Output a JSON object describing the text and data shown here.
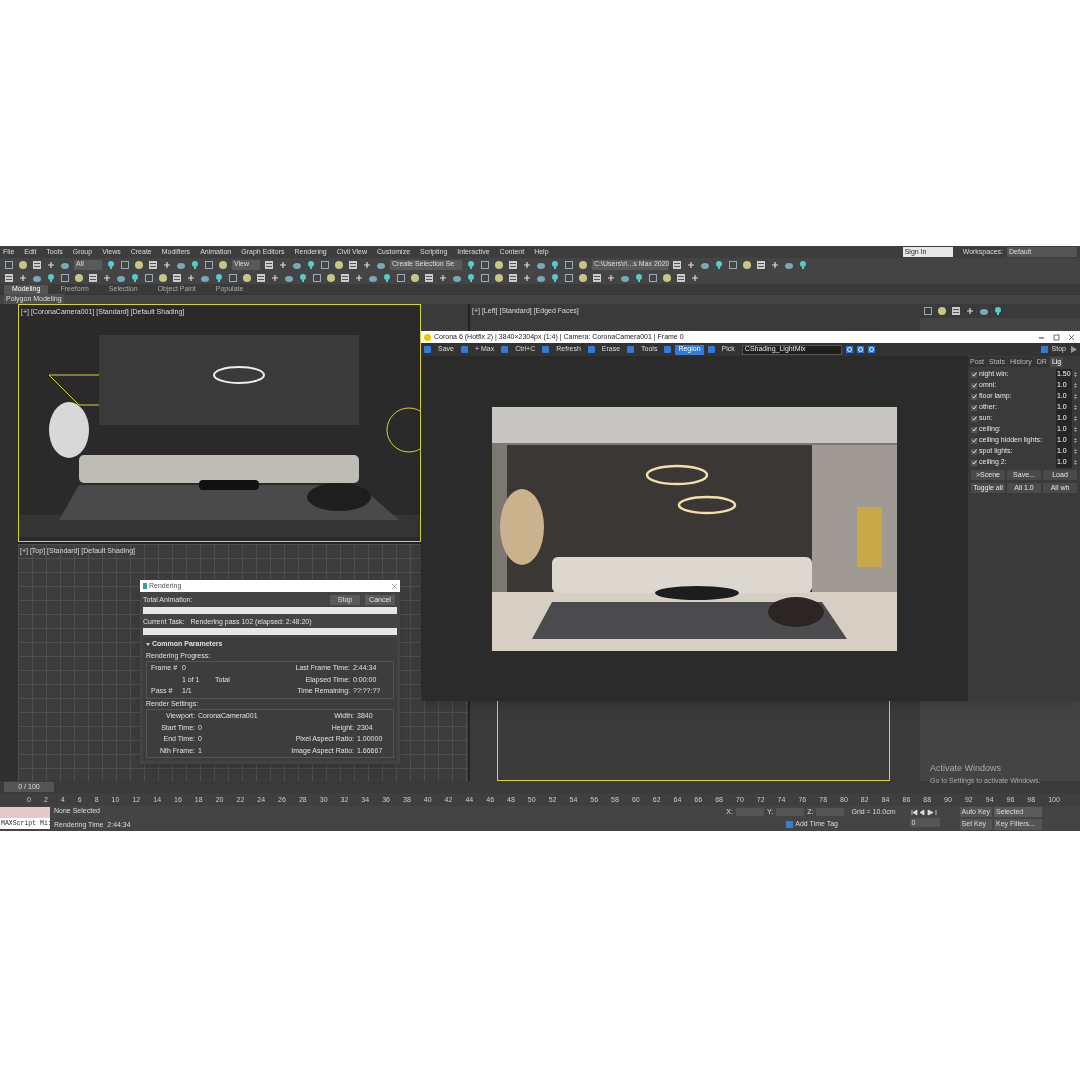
{
  "menu": [
    "File",
    "Edit",
    "Tools",
    "Group",
    "Views",
    "Create",
    "Modifiers",
    "Animation",
    "Graph Editors",
    "Rendering",
    "Civil View",
    "Customize",
    "Scripting",
    "Interactive",
    "Content",
    "Help"
  ],
  "account": {
    "sign_in": "Sign In",
    "workspaces_label": "Workspaces:",
    "workspace": "Default"
  },
  "toolbar": {
    "selection_filter": "All",
    "reference_coord": "View",
    "selection_set": "Create Selection Se",
    "project_path": "C:\\Users\\r\\...s Max 2020"
  },
  "ribbon_tabs": [
    {
      "label": "Modeling",
      "selected": true
    },
    {
      "label": "Freeform",
      "selected": false
    },
    {
      "label": "Selection",
      "selected": false
    },
    {
      "label": "Object Paint",
      "selected": false
    },
    {
      "label": "Populate",
      "selected": false
    }
  ],
  "ribbon_panel": "Polygon Modeling",
  "viewports": [
    {
      "kind": "camera",
      "label": "[+] [CoronaCamera001] [Standard] [Default Shading]"
    },
    {
      "kind": "side",
      "label": "[+] [Left] [Standard] [Edged Faces]"
    },
    {
      "kind": "top",
      "label": "[+] [Top] [Standard] [Default Shading]"
    },
    {
      "kind": "hidden"
    }
  ],
  "frame_buffer": {
    "title": "Corona 6 (Hotfix 2) | 3840×2304px (1:4) | Camera: CoronaCamera001 | Frame 0",
    "tools": [
      {
        "label": "Save",
        "selected": false
      },
      {
        "label": "+ Max",
        "selected": false
      },
      {
        "label": "Ctrl+C",
        "selected": false
      },
      {
        "label": "Refresh",
        "selected": false
      },
      {
        "label": "Erase",
        "selected": false
      },
      {
        "label": "Tools",
        "selected": false
      },
      {
        "label": "Region",
        "selected": true
      },
      {
        "label": "Pick",
        "selected": false
      }
    ],
    "render_element": "CShading_LightMix",
    "stop": "Stop",
    "tabs": [
      {
        "label": "Post",
        "selected": false
      },
      {
        "label": "Stats",
        "selected": false
      },
      {
        "label": "History",
        "selected": false
      },
      {
        "label": "DR",
        "selected": false
      },
      {
        "label": "Lig",
        "selected": true
      }
    ],
    "lights": [
      {
        "name": "night win:",
        "checked": true,
        "value": "1.50"
      },
      {
        "name": "omni:",
        "checked": true,
        "value": "1.0"
      },
      {
        "name": "floor lamp:",
        "checked": true,
        "value": "1.0"
      },
      {
        "name": "other:",
        "checked": true,
        "value": "1.0"
      },
      {
        "name": "sun:",
        "checked": true,
        "value": "1.0"
      },
      {
        "name": "ceiling:",
        "checked": true,
        "value": "1.0"
      },
      {
        "name": "ceiling hidden lights:",
        "checked": true,
        "value": "1.0"
      },
      {
        "name": "spot lights:",
        "checked": true,
        "value": "1.0"
      },
      {
        "name": "ceiling 2:",
        "checked": true,
        "value": "1.0"
      }
    ],
    "buttons": [
      ">Scene",
      "Save...",
      "Load"
    ],
    "buttons_2": [
      "Toggle all",
      "All 1.0",
      "All wh"
    ]
  },
  "rendering_dialog": {
    "title": "Rendering",
    "stop": "Stop",
    "cancel": "Cancel",
    "total_animation": "Total Animation:",
    "total_progress": {
      "level": 0
    },
    "task_progress": {
      "level": 0
    },
    "current_task_label": "Current Task:",
    "current_task": "Rendering pass 102 (elapsed: 2:48:20)",
    "section": "Common Parameters",
    "progress_heading": "Rendering Progress:",
    "progress_rows": [
      [
        "Frame #",
        "0",
        "",
        "Last Frame Time:",
        "2:44:34"
      ],
      [
        "",
        "1 of 1",
        "Total",
        "Elapsed Time:",
        "0:00:00"
      ],
      [
        "Pass #",
        "1/1",
        "",
        "Time Remaining:",
        "??:??:??"
      ]
    ],
    "settings_heading": "Render Settings:",
    "settings_rows": [
      [
        "Viewport:",
        "CoronaCamera001",
        "Width:",
        "3840"
      ],
      [
        "Start Time:",
        "0",
        "Height:",
        "2304"
      ],
      [
        "End Time:",
        "0",
        "Pixel Aspect Ratio:",
        "1.00000"
      ],
      [
        "Nth Frame:",
        "1",
        "Image Aspect Ratio:",
        "1.66667"
      ]
    ]
  },
  "timeline": {
    "position": "0 / 100",
    "level": 0,
    "ticks": [
      "0",
      "2",
      "4",
      "6",
      "8",
      "10",
      "12",
      "14",
      "16",
      "18",
      "20",
      "22",
      "24",
      "26",
      "28",
      "30",
      "32",
      "34",
      "36",
      "38",
      "40",
      "42",
      "44",
      "46",
      "48",
      "50",
      "52",
      "54",
      "56",
      "58",
      "60",
      "62",
      "64",
      "66",
      "68",
      "70",
      "72",
      "74",
      "76",
      "78",
      "80",
      "82",
      "84",
      "86",
      "88",
      "90",
      "92",
      "94",
      "96",
      "98",
      "100"
    ]
  },
  "status": {
    "maxscript": "MAXScript Mi:",
    "selection": "None Selected",
    "render_time": "Rendering Time  2:44:34",
    "x": "X:",
    "y": "Y:",
    "z": "Z:",
    "grid": "Grid = 10.0cm",
    "add_time_tag": "Add Time Tag",
    "frame": "0",
    "auto_key": "Auto Key",
    "set_key": "Set Key",
    "key_mode": "Selected",
    "key_filters": "Key Filters..."
  },
  "os_notice": {
    "title": "Activate Windows",
    "subtitle": "Go to Settings to activate Windows."
  }
}
